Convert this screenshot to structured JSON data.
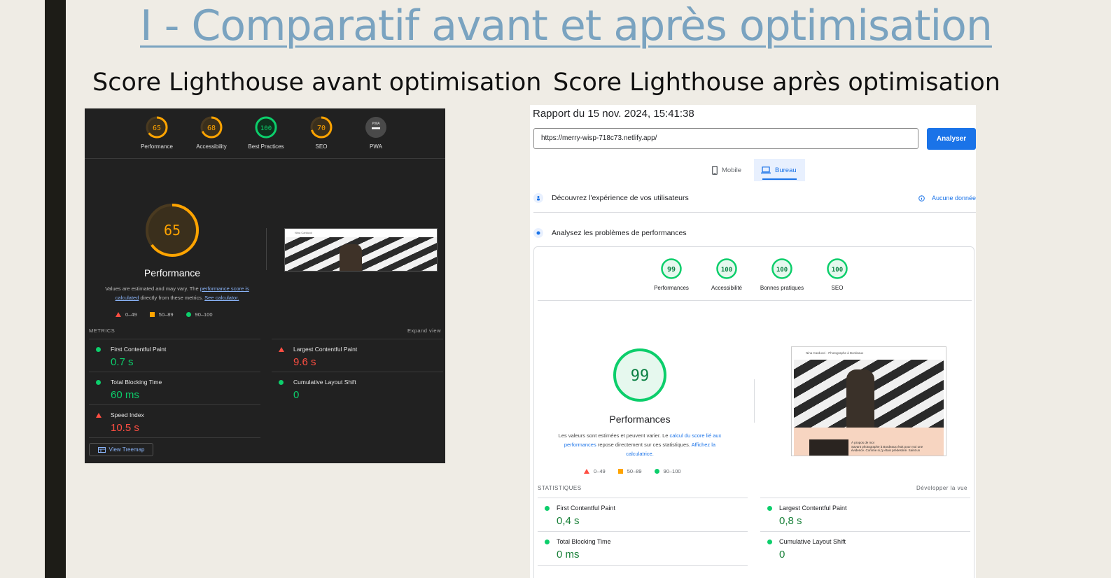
{
  "slide": {
    "title": "I - Comparatif avant et après optimisation",
    "left_heading": "Score Lighthouse avant optimisation",
    "right_heading": "Score Lighthouse après optimisation"
  },
  "before": {
    "gauges": [
      {
        "score": "65",
        "label": "Performance"
      },
      {
        "score": "68",
        "label": "Accessibility"
      },
      {
        "score": "100",
        "label": "Best Practices"
      },
      {
        "score": "70",
        "label": "SEO"
      },
      {
        "score": "PWA",
        "label": "PWA"
      }
    ],
    "big_score": "65",
    "perf_title": "Performance",
    "note_prefix": "Values are estimated and may vary. The ",
    "note_link1": "performance score is calculated",
    "note_middle": " directly from these metrics. ",
    "note_link2": "See calculator.",
    "legend": [
      "0–49",
      "50–89",
      "90–100"
    ],
    "metrics_label": "METRICS",
    "expand_label": "Expand view",
    "metrics": [
      {
        "name": "First Contentful Paint",
        "value": "0.7 s"
      },
      {
        "name": "Largest Contentful Paint",
        "value": "9.6 s"
      },
      {
        "name": "Total Blocking Time",
        "value": "60 ms"
      },
      {
        "name": "Cumulative Layout Shift",
        "value": "0"
      },
      {
        "name": "Speed Index",
        "value": "10.5 s"
      }
    ],
    "treemap_label": "View Treemap",
    "preview_site_name": "Nina Carducci"
  },
  "after": {
    "report_title": "Rapport du 15 nov. 2024, 15:41:38",
    "url_value": "https://merry-wisp-718c73.netlify.app/",
    "analyze_label": "Analyser",
    "tabs": [
      {
        "label": "Mobile"
      },
      {
        "label": "Bureau"
      }
    ],
    "discover_label": "Découvrez l'expérience de vos utilisateurs",
    "no_data_label": "Aucune donnée",
    "analyze_problems_label": "Analysez les problèmes de performances",
    "gauges": [
      {
        "score": "99",
        "label": "Performances"
      },
      {
        "score": "100",
        "label": "Accessibilité"
      },
      {
        "score": "100",
        "label": "Bonnes pratiques"
      },
      {
        "score": "100",
        "label": "SEO"
      }
    ],
    "big_score": "99",
    "perf_title": "Performances",
    "note_prefix": "Les valeurs sont estimées et peuvent varier. Le ",
    "note_link1": "calcul du score lié aux performances",
    "note_middle": " repose directement sur ces statistiques. ",
    "note_link2": "Affichez la calculatrice.",
    "legend": [
      "0–49",
      "50–89",
      "90–100"
    ],
    "stats_label": "STATISTIQUES",
    "expand_label": "Développer la vue",
    "metrics": [
      {
        "name": "First Contentful Paint",
        "value": "0,4 s"
      },
      {
        "name": "Largest Contentful Paint",
        "value": "0,8 s"
      },
      {
        "name": "Total Blocking Time",
        "value": "0 ms"
      },
      {
        "name": "Cumulative Layout Shift",
        "value": "0"
      }
    ],
    "preview_header": "Nina Carducci - Photographe à Bordeaux",
    "preview_about_title": "À propos de moi",
    "preview_about_text": "Savant photographe à Bordeaux étoit pour moi une évidence. Comme si j'y étais prédestiné. Saint un"
  },
  "colors": {
    "pass": "#0cce6b",
    "average": "#ffa400",
    "fail": "#ff4e42",
    "accent_blue": "#1a73e8",
    "title_blue": "#7aa3c0"
  }
}
